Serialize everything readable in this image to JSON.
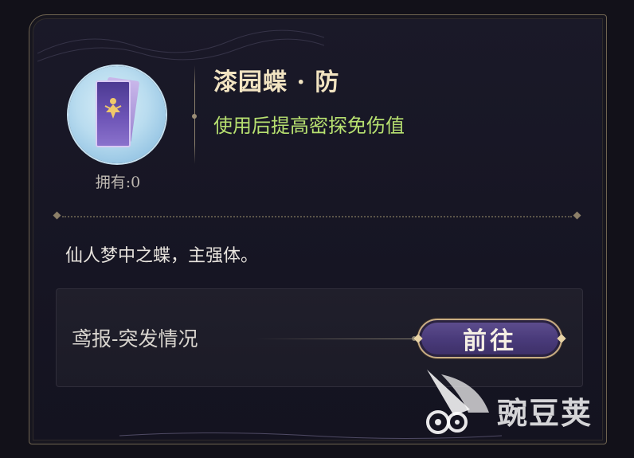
{
  "item": {
    "name": "漆园蝶 · 防",
    "effect": "使用后提高密探免伤值",
    "owned": "拥有:0",
    "flavor": "仙人梦中之蝶，主强体。"
  },
  "source": {
    "label": "鸢报-突发情况",
    "button_label": "前往"
  },
  "watermark": {
    "text": "豌豆荚"
  },
  "icons": {
    "item": "butterfly-card-icon",
    "watermark": "wandoujia-logo-icon"
  },
  "colors": {
    "title": "#f1e3c1",
    "effect": "#b7e070",
    "button_bg": "#4a3b7b",
    "button_border": "#c8ad83"
  }
}
